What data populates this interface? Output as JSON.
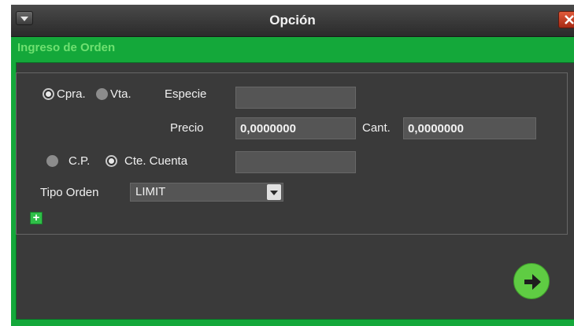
{
  "window": {
    "title": "Opción",
    "menu_icon": "chevron-down-icon",
    "close_icon": "close-icon"
  },
  "section": {
    "title": "Ingreso de Orden"
  },
  "form": {
    "side": {
      "options": [
        {
          "label": "Cpra.",
          "selected": true
        },
        {
          "label": "Vta.",
          "selected": false
        }
      ]
    },
    "especie": {
      "label": "Especie",
      "value": ""
    },
    "precio": {
      "label": "Precio",
      "value": "0,0000000"
    },
    "cantidad": {
      "label": "Cant.",
      "value": "0,0000000"
    },
    "account_type": {
      "options": [
        {
          "label": "C.P.",
          "selected": false
        },
        {
          "label": "Cte. Cuenta",
          "selected": true
        }
      ],
      "value": ""
    },
    "tipo_orden": {
      "label": "Tipo Orden",
      "value": "LIMIT"
    },
    "add_icon": "plus-icon",
    "submit_icon": "arrow-right-icon"
  },
  "colors": {
    "accent_green": "#14a83a",
    "section_title_green": "#6fe070",
    "background": "#3a3a3a",
    "close_red": "#c8401e",
    "submit_green": "#5fcc43"
  }
}
